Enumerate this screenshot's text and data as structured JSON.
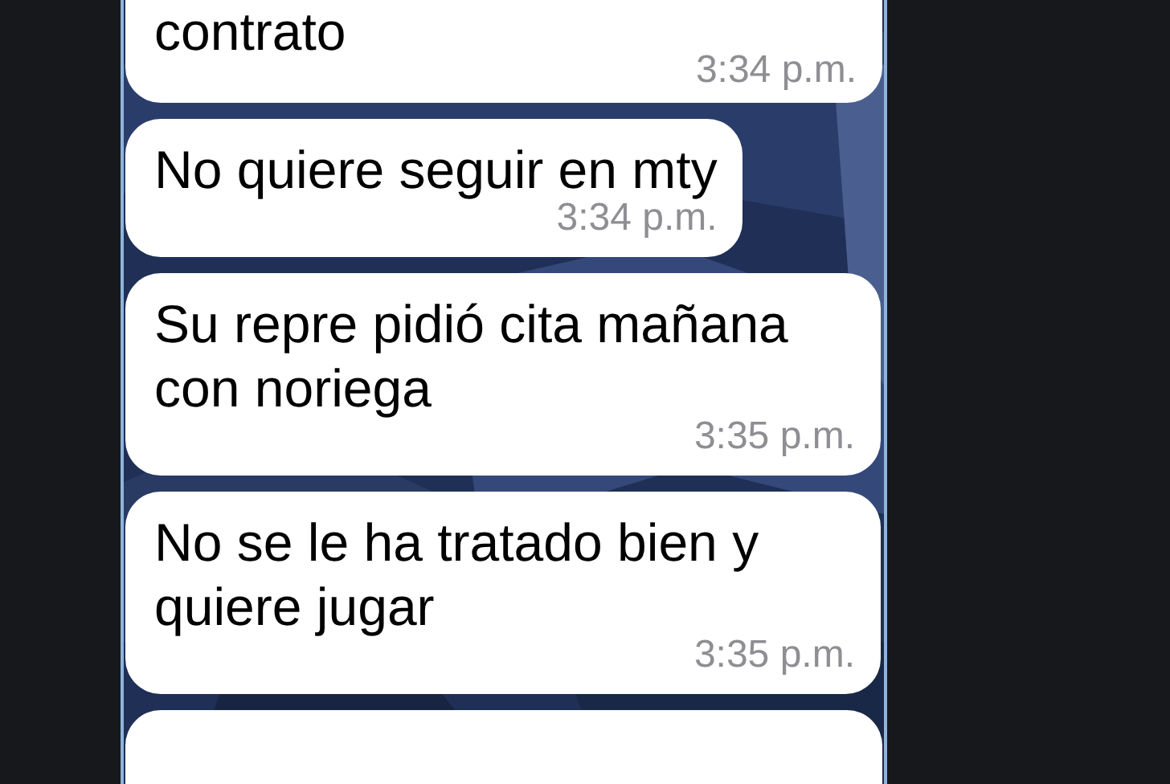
{
  "messages": [
    {
      "kind": "text",
      "text": "contrato",
      "time": "3:34 p.m."
    },
    {
      "kind": "text",
      "text": "No quiere seguir en mty",
      "time": "3:34 p.m."
    },
    {
      "kind": "text",
      "text": "Su repre pidió cita mañana con noriega",
      "time": "3:35 p.m."
    },
    {
      "kind": "text",
      "text": "No se le ha tratado bien y quiere jugar",
      "time": "3:35 p.m."
    },
    {
      "kind": "cut"
    }
  ]
}
